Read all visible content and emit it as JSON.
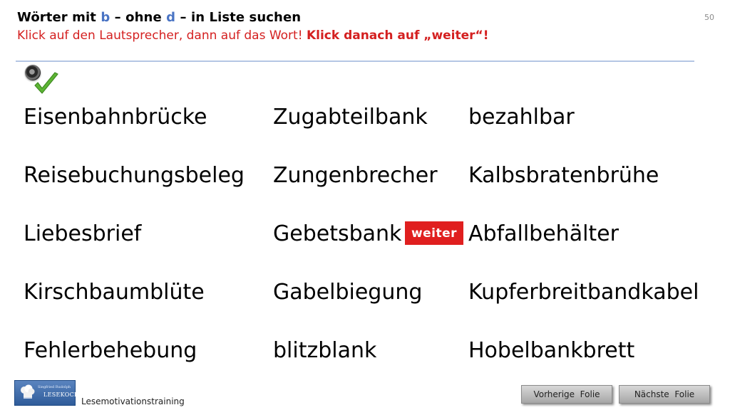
{
  "header": {
    "title_part1": "Wörter mit ",
    "title_b": "b",
    "title_part2": " – ohne ",
    "title_d": "d",
    "title_part3": " – in Liste suchen",
    "instruction_plain": "Klick auf den Lautsprecher, dann auf das Wort! ",
    "instruction_bold": "Klick danach auf „weiter“!",
    "slide_number": "50"
  },
  "colors": {
    "highlight_blue": "#4a74c4",
    "instruction_red": "#d42020",
    "weiter_button_red": "#e01f1f",
    "rule_blue": "#b4c6e4"
  },
  "icons": {
    "speaker": "speaker-icon",
    "check": "checkmark-icon"
  },
  "words": {
    "col1": [
      "Eisenbahnbrücke",
      "Reisebuchungsbeleg",
      "Liebesbrief",
      "Kirschbaumblüte",
      "Fehlerbehebung"
    ],
    "col2": [
      "Zugabteilbank",
      "Zungenbrecher",
      "Gebetsbank",
      "Gabelbiegung",
      "blitzblank"
    ],
    "col3": [
      "bezahlbar",
      "Kalbsbratenbrühe",
      "Abfallbehälter",
      "Kupferbreitbandkabel",
      "Hobelbankbrett"
    ]
  },
  "weiter_label": "weiter",
  "footer": {
    "logo_small": "Siegfried Rudolph",
    "logo_main": "LESEKOCH",
    "label": "Lesemotivationstraining",
    "prev_label": "Vorherige  Folie",
    "next_label": "Nächste  Folie"
  }
}
